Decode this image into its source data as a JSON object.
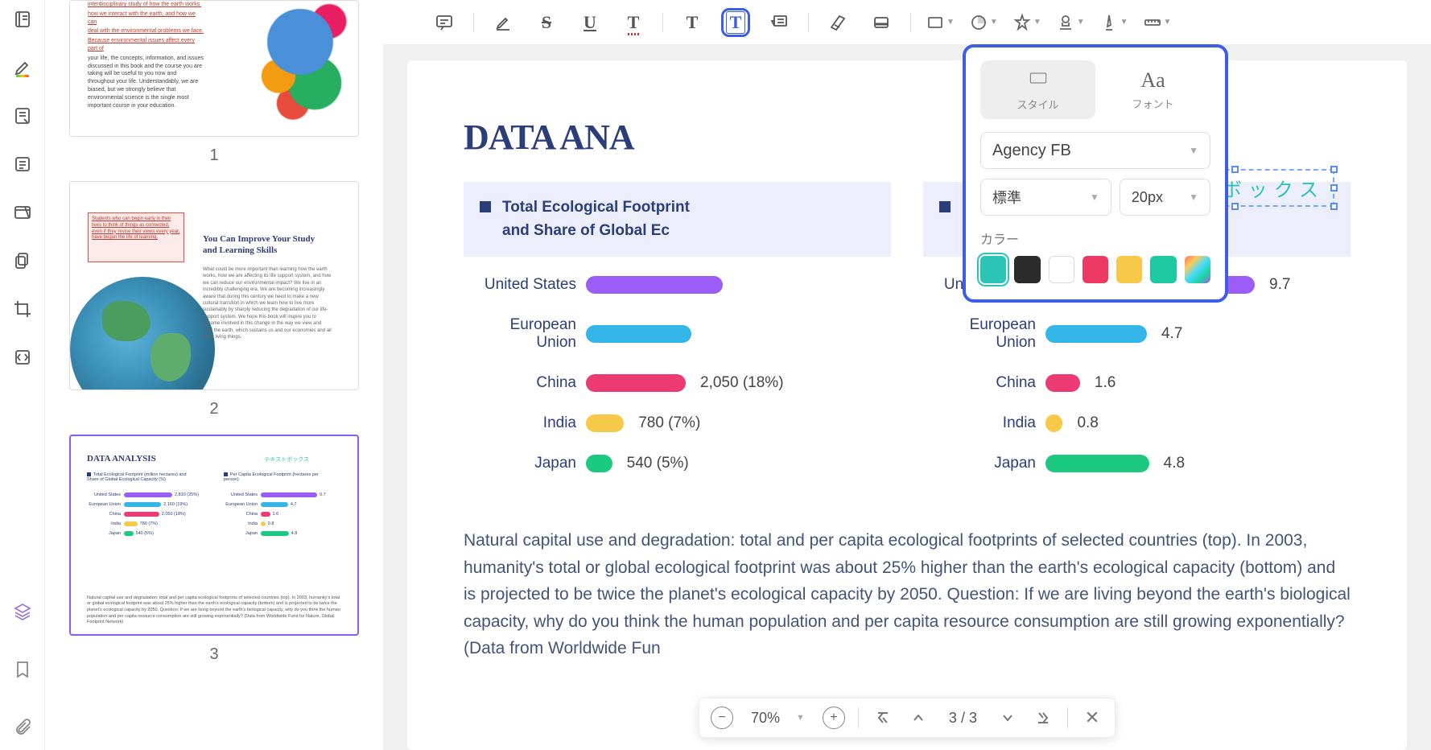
{
  "toolbar": {
    "comment": "comment",
    "highlight": "highlight",
    "strikethrough": "S",
    "underline": "U",
    "squiggly": "T",
    "text": "T",
    "textbox": "T",
    "indent": "indent",
    "fontcolor": "A",
    "fill": "fill",
    "background": "bg",
    "shape": "shape",
    "pin": "pin",
    "stamp": "stamp",
    "ink": "ink",
    "ruler": "ruler"
  },
  "font_panel": {
    "tab_style": "スタイル",
    "tab_font": "フォント",
    "tab_font_icon": "Aa",
    "font_family": "Agency FB",
    "weight": "標準",
    "size": "20px",
    "color_label": "カラー",
    "colors": [
      "#2bc4b6",
      "#2b2b2b",
      "#ffffff",
      "#ec3a62",
      "#f7c948",
      "#1dc9a0",
      "rainbow"
    ],
    "selected_color_index": 0
  },
  "text_box": {
    "content": "キストボックス"
  },
  "page": {
    "title": "DATA ANA",
    "left_chart_header": "Total Ecological Footprint\nand Share of Global Ec",
    "right_chart_header": "Per Capita Ecological Footprint (hectares per person)",
    "body": "Natural capital use and degradation: total and per capita ecological footprints of selected countries (top). In 2003, humanity's total or global ecological footprint was about 25% higher than the earth's ecological capacity (bottom) and is projected to be twice the planet's ecological capacity by 2050. Question: If we are living beyond the earth's biological capacity, why do you think the human population and per capita resource consumption are still growing exponentially? (Data from Worldwide Fun"
  },
  "chart_data": [
    {
      "type": "bar",
      "title": "Total Ecological Footprint (million hectares) and Share of Global Ecological Capacity (%)",
      "categories": [
        "United States",
        "European Union",
        "China",
        "India",
        "Japan"
      ],
      "values_label": [
        "",
        "",
        "2,050 (18%)",
        "780 (7%)",
        "540 (5%)"
      ],
      "values": [
        2810,
        2160,
        2050,
        780,
        540
      ],
      "share_pct": [
        25,
        19,
        18,
        7,
        5
      ],
      "colors": [
        "#9b5cf7",
        "#35b6e8",
        "#ec3a72",
        "#f7c948",
        "#1dc980"
      ]
    },
    {
      "type": "bar",
      "title": "Per Capita Ecological Footprint (hectares per person)",
      "categories": [
        "United States",
        "European Union",
        "China",
        "India",
        "Japan"
      ],
      "values": [
        9.7,
        4.7,
        1.6,
        0.8,
        4.8
      ],
      "colors": [
        "#9b5cf7",
        "#35b6e8",
        "#ec3a72",
        "#f7c948",
        "#1dc980"
      ]
    }
  ],
  "thumbs": {
    "nums": [
      "1",
      "2",
      "3"
    ],
    "t1_red1": "interdisciplinary study of how the earth works.",
    "t1_red2": "how we interact with the earth, and how we can",
    "t1_red3": "deal with the environmental problems we face.",
    "t1_red4": "Because environmental issues affect every part of",
    "t1_body": "your life, the concepts, information, and issues discussed in this book and the course you are taking will be useful to you now and throughout your life. Understandably, we are biased, but we strongly believe that environmental science is the single most important course in your education.",
    "t2_box": "Students who can begin early in their lives to think of things as connected, even if they revise their views every year, have begun the life of learning.",
    "t2_title": "You Can Improve Your Study and Learning Skills",
    "t2_body": "What could be more important than learning how the earth works, how we are affecting its life support system, and how we can reduce our environmental impact? We live in an incredibly challenging era. We are becoming increasingly aware that during this century we need to make a new cultural transition in which we learn how to live more sustainably by sharply reducing the degradation of our life-support system. We hope this book will inspire you to become involved in this change in the way we view and treat the earth, which sustains us and our economies and all other living things.",
    "t3_title": "DATA ANALYSIS",
    "t3_textbox": "テキストボックス",
    "t3_legend_l": "Total Ecological Footprint (million hectares) and Share of Global Ecological Capacity (%)",
    "t3_legend_r": "Per Capita Ecological Footprint (hectares per person)",
    "t3_para": "Natural capital use and degradation: total and per capita ecological footprints of selected countries (top). In 2003, humanity's total or global ecological footprint was about 25% higher than the earth's ecological capacity (bottom) and is projected to be twice the planet's ecological capacity by 2050. Question: If we are living beyond the earth's biological capacity, why do you think the human population and per capita resource consumption are still growing exponentially? (Data from Worldwide Fund for Nature, Global Footprint Network)"
  },
  "page_nav": {
    "zoom": "70%",
    "current": "3",
    "total": "3",
    "sep": "/"
  }
}
